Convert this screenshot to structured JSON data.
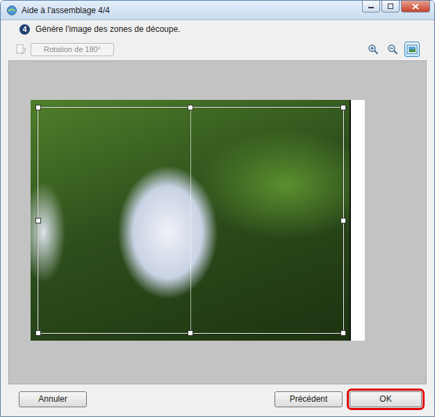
{
  "window": {
    "title": "Aide à l'assemblage 4/4"
  },
  "step": {
    "number": "4",
    "text": "Génère l'image des zones de découpe."
  },
  "toolbar": {
    "rotate": {
      "label": "Rotation de 180°",
      "disabled": true
    },
    "tools": [
      {
        "kind": "zoom-in",
        "selected": false
      },
      {
        "kind": "zoom-out",
        "selected": false
      },
      {
        "kind": "fit",
        "selected": true
      }
    ]
  },
  "buttons": [
    {
      "label": "Annuler",
      "highlighted": false
    },
    {
      "label": "Précédent",
      "highlighted": false
    },
    {
      "label": "OK",
      "highlighted": true
    }
  ]
}
